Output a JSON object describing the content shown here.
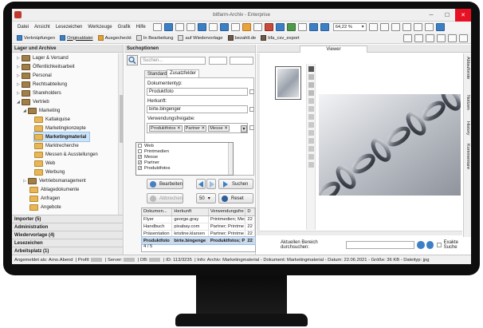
{
  "window": {
    "title": "bitfarm-Archiv - Enterprise"
  },
  "menu": [
    "Datei",
    "Ansicht",
    "Lesezeichen",
    "Werkzeuge",
    "Grafik",
    "Hilfe"
  ],
  "toolbar": {
    "zoom": "64,22 %"
  },
  "toolbar2": {
    "items": [
      "Verknüpfungen",
      "Originaldatei",
      "Ausgecheckt",
      "In Bearbeitung",
      "auf Wiedervorlage",
      "bezahlt.de",
      "bfa_csv_export"
    ]
  },
  "left": {
    "header": "Lager und Archive",
    "tree": [
      "Lager & Versand",
      "Öffentlichkeitsarbeit",
      "Personal",
      "Rechtsabteilung",
      "Shareholders",
      "Vertrieb",
      "Marketing",
      "Kaltakquise",
      "Marketingkonzepte",
      "Marketingmaterial",
      "Marktrecherche",
      "Messen & Ausstellungen",
      "Web",
      "Werbung",
      "Vertriebsmanagement",
      "Ablagedokumente",
      "Anfragen",
      "Angebote"
    ],
    "sections": [
      "Importer (5)",
      "Administration",
      "Wiedervorlage (4)",
      "Lesezeichen",
      "Arbeitsplatz (1)"
    ]
  },
  "search": {
    "header": "Suchoptionen",
    "placeholder": "Suchen...",
    "tab_standard": "Standard",
    "tab_extra": "Zusatzfelder",
    "doctype_label": "Dokumententyp:",
    "doctype_value": "Produktfoto",
    "origin_label": "Herkunft:",
    "origin_value": "birte.bingenger",
    "usage_label": "Verwendungsfreigabe:",
    "usage_tags": [
      "Produktfotos",
      "Partner",
      "Messe"
    ],
    "usage_options": [
      {
        "label": "Web",
        "checked": false
      },
      {
        "label": "Printmedien",
        "checked": false
      },
      {
        "label": "Messe",
        "checked": true
      },
      {
        "label": "Partner",
        "checked": true
      },
      {
        "label": "Produktfotos",
        "checked": true
      }
    ],
    "btn_edit": "Bearbeiten",
    "btn_cancel": "Abbrechen",
    "btn_search": "Suchen",
    "btn_reset": "Reset",
    "count_select": "50",
    "results_columns": [
      "Dokumen...",
      "Herkunft",
      "Verwendungsfre",
      "D"
    ],
    "results_rows": [
      [
        "Flyer",
        "george.gray",
        "Printmedien; Mes",
        "22"
      ],
      [
        "Handbuch",
        "pixabay.com",
        "Partner; Printme",
        "22"
      ],
      [
        "Präsentation",
        "kristine.klarsen",
        "Partner; Printme",
        "22"
      ],
      [
        "Produktfoto",
        "birte.bingenge",
        "Produktfotos; P",
        "22"
      ]
    ],
    "selected_row": 3,
    "pager": "4 / 5"
  },
  "viewer": {
    "tab": "Viewer",
    "side_tabs": [
      "Ablauforste",
      "Notizen",
      "History",
      "Kommentare"
    ],
    "search_label": "Aktuellen Bereich durchsuchen:",
    "exact_label": "Exakte Suche"
  },
  "status": {
    "user_label": "Angemeldet als:",
    "user": "Arno.Abend",
    "profile_label": "Profil:",
    "server_label": "Server:",
    "db_label": "DB:",
    "id_label": "ID:",
    "id": "113/3235",
    "info": "Info: Archiv: Marketingmaterial - Dokument: Marketingmaterial - Datum: 22.06.2021 - Größe: 36 KB - Dateityp: jpg"
  }
}
